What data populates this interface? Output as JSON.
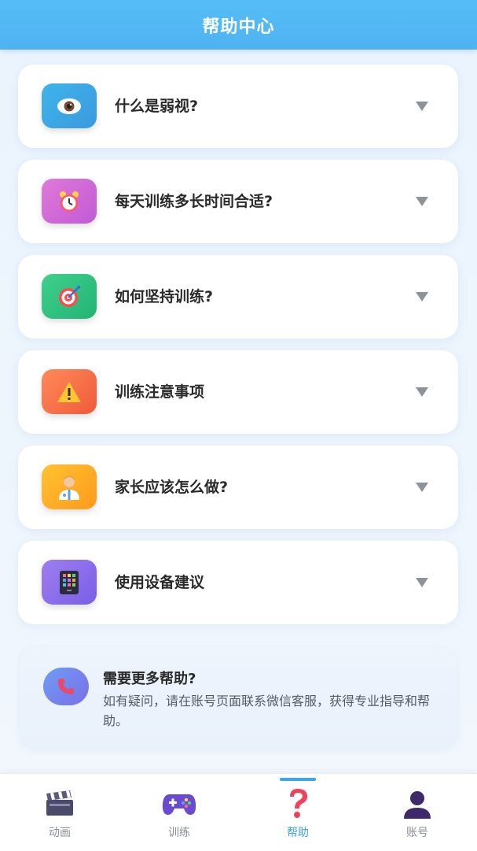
{
  "header": {
    "title": "帮助中心"
  },
  "faq": [
    {
      "label": "什么是弱视?",
      "icon": "eye-icon",
      "color_from": "#3fb4ea",
      "color_to": "#3a9ae0"
    },
    {
      "label": "每天训练多长时间合适?",
      "icon": "alarm-clock-icon",
      "color_from": "#e07ad8",
      "color_to": "#c05ad6"
    },
    {
      "label": "如何坚持训练?",
      "icon": "target-icon",
      "color_from": "#3fd08c",
      "color_to": "#22b474"
    },
    {
      "label": "训练注意事项",
      "icon": "warning-icon",
      "color_from": "#ff8a5a",
      "color_to": "#f05a3a"
    },
    {
      "label": "家长应该怎么做?",
      "icon": "doctor-icon",
      "color_from": "#ffc233",
      "color_to": "#ff9a1a"
    },
    {
      "label": "使用设备建议",
      "icon": "tablet-icon",
      "color_from": "#9d7ff0",
      "color_to": "#7a5ee6"
    }
  ],
  "help_card": {
    "title": "需要更多帮助?",
    "description": "如有疑问，请在账号页面联系微信客服，获得专业指导和帮助。",
    "icon": "phone-icon"
  },
  "nav": [
    {
      "label": "动画",
      "icon": "clapperboard-icon",
      "active": false
    },
    {
      "label": "训练",
      "icon": "gamepad-icon",
      "active": false
    },
    {
      "label": "帮助",
      "icon": "question-icon",
      "active": true
    },
    {
      "label": "账号",
      "icon": "user-icon",
      "active": false
    }
  ],
  "colors": {
    "header": "#4fb3f2",
    "active_tab": "#3aa3ea"
  }
}
